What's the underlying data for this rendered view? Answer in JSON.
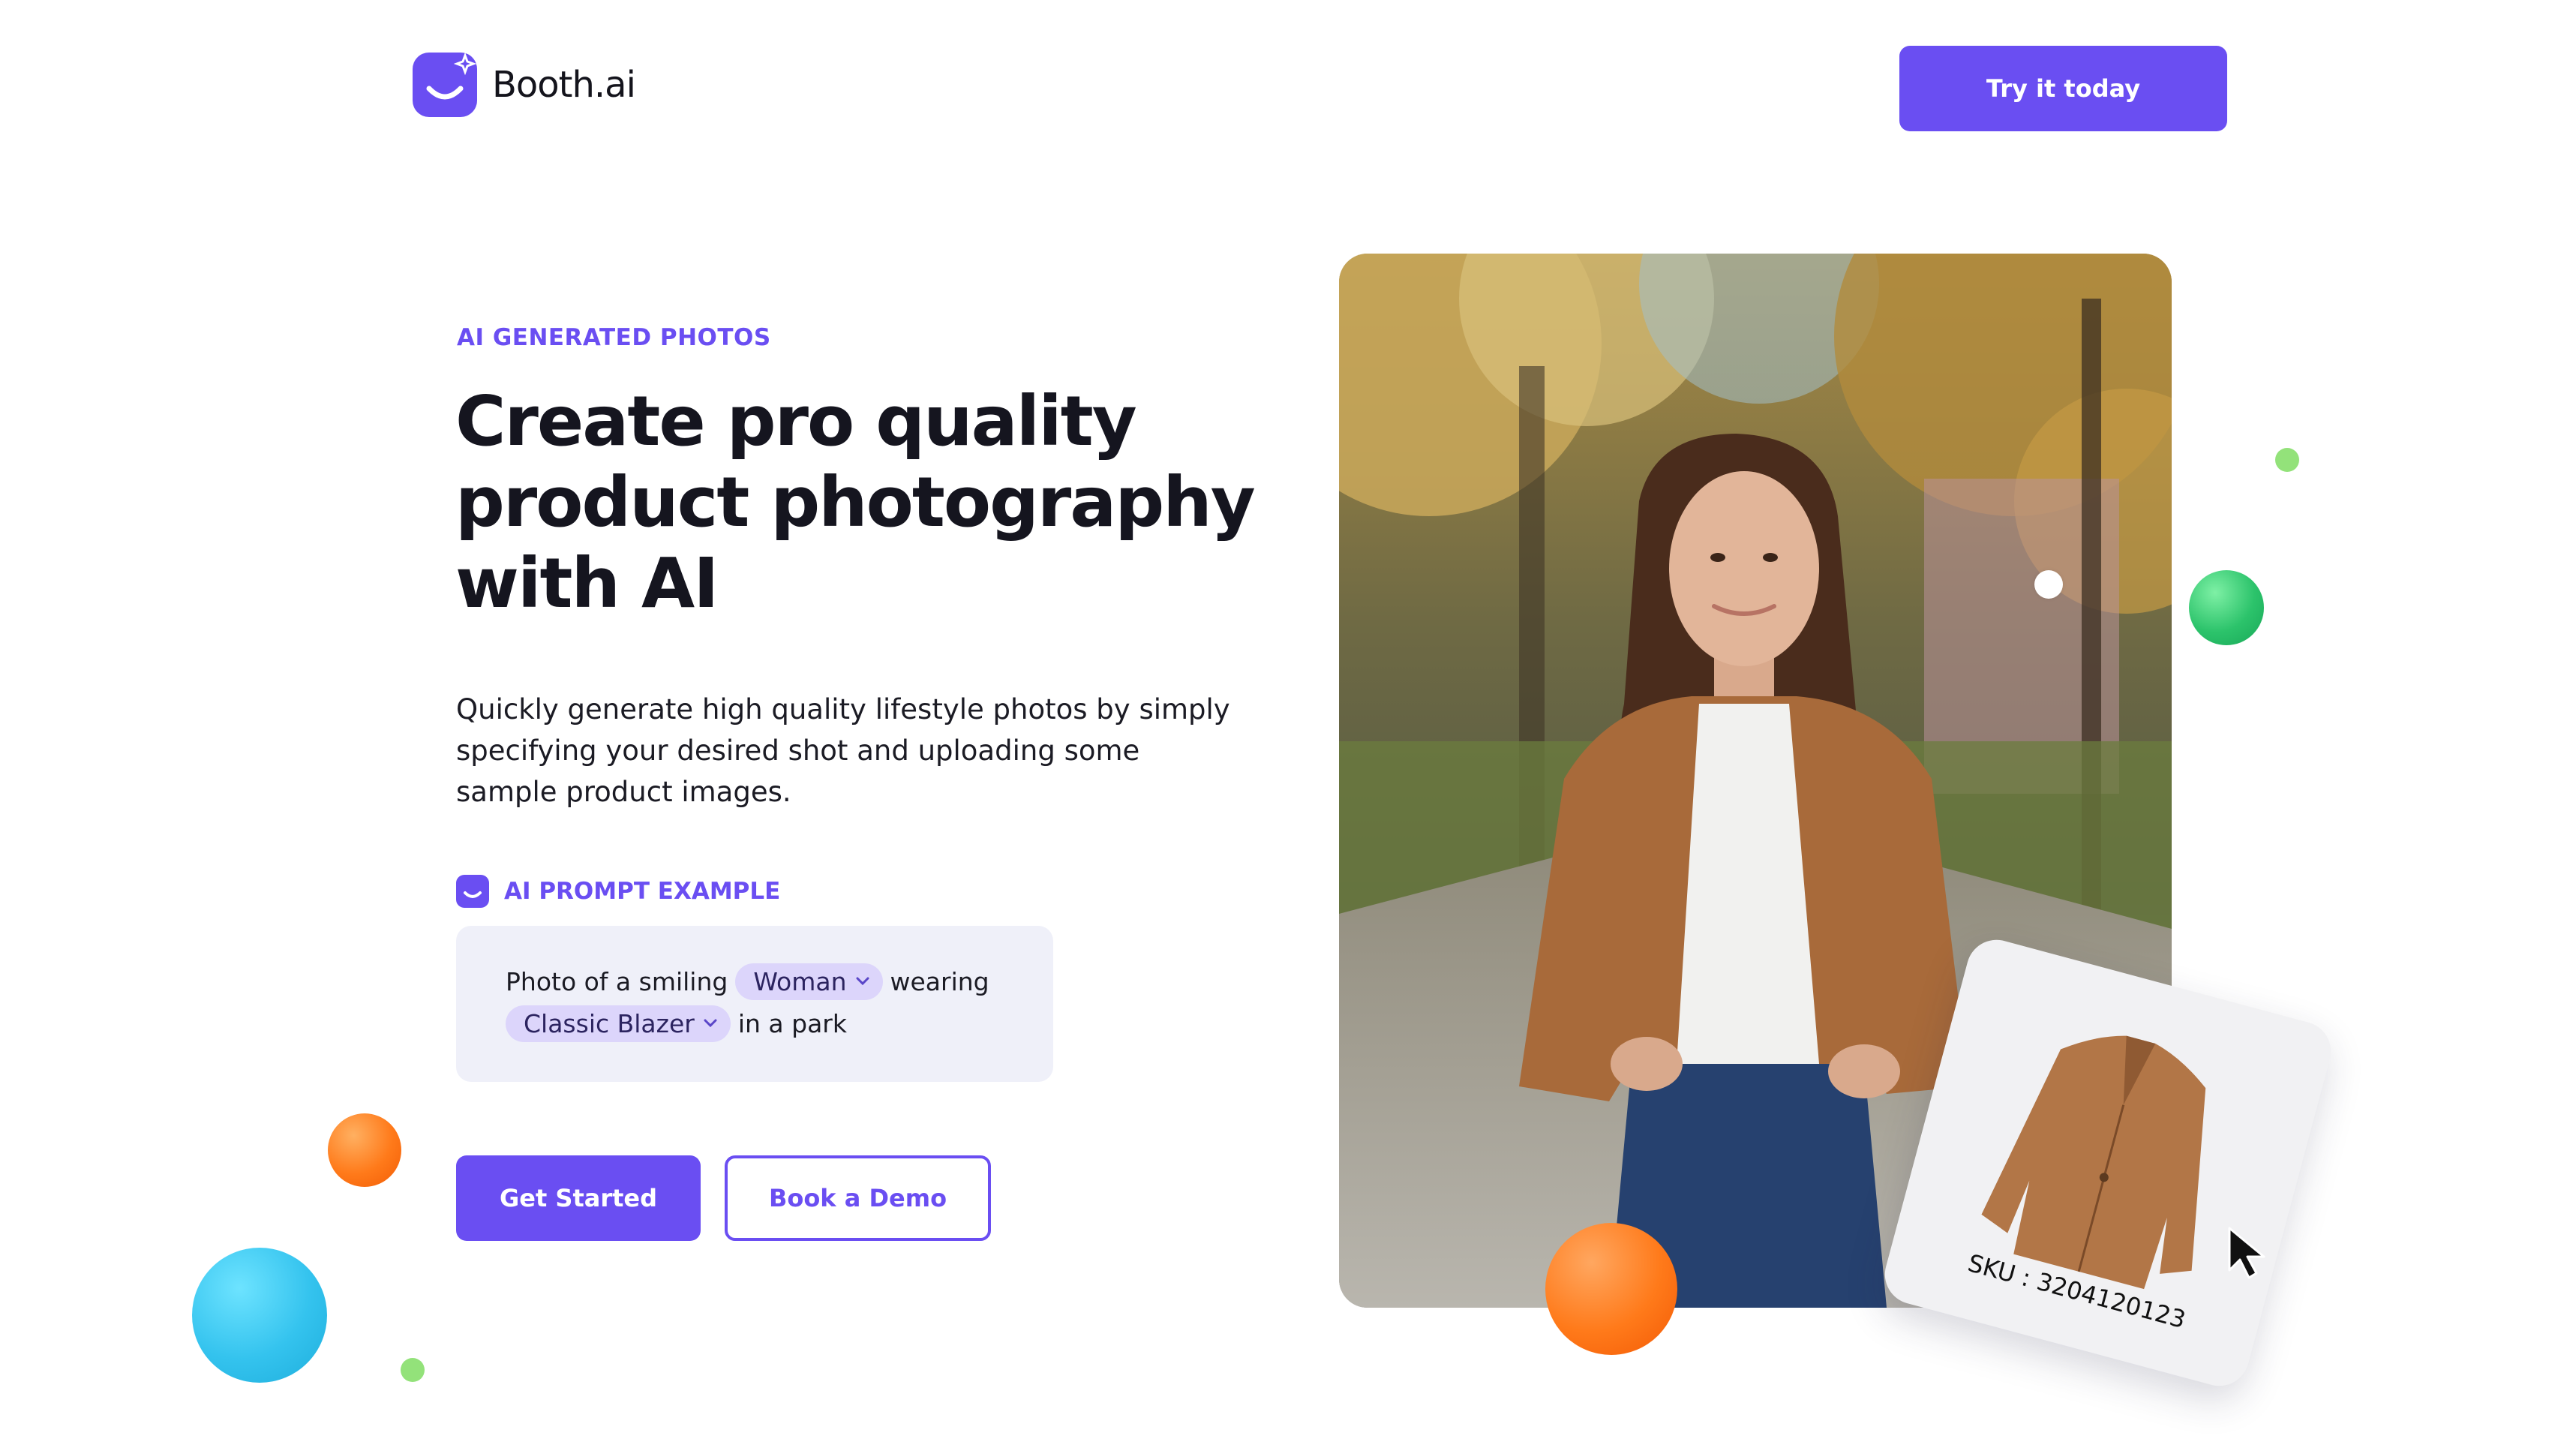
{
  "header": {
    "logo_text": "Booth.ai",
    "cta_label": "Try it today"
  },
  "hero": {
    "eyebrow": "AI GENERATED PHOTOS",
    "headline_line1": "Create pro quality",
    "headline_line2": "product photography",
    "headline_line3": "with AI",
    "lead_line1": "Quickly generate high quality lifestyle photos by simply",
    "lead_line2": "specifying your desired shot and uploading some",
    "lead_line3": "sample product images.",
    "prompt_label": "AI PROMPT EXAMPLE",
    "prompt": {
      "text1": "Photo of a smiling",
      "chip1": "Woman",
      "text2": "wearing",
      "chip2": "Classic Blazer",
      "text3": "in a park"
    },
    "primary_button": "Get Started",
    "secondary_button": "Book a Demo"
  },
  "product_card": {
    "sku": "SKU : 3204120123"
  },
  "colors": {
    "brand": "#6a4ef2",
    "chip_bg": "#dcd5fb",
    "prompt_bg": "#eff0f9"
  }
}
